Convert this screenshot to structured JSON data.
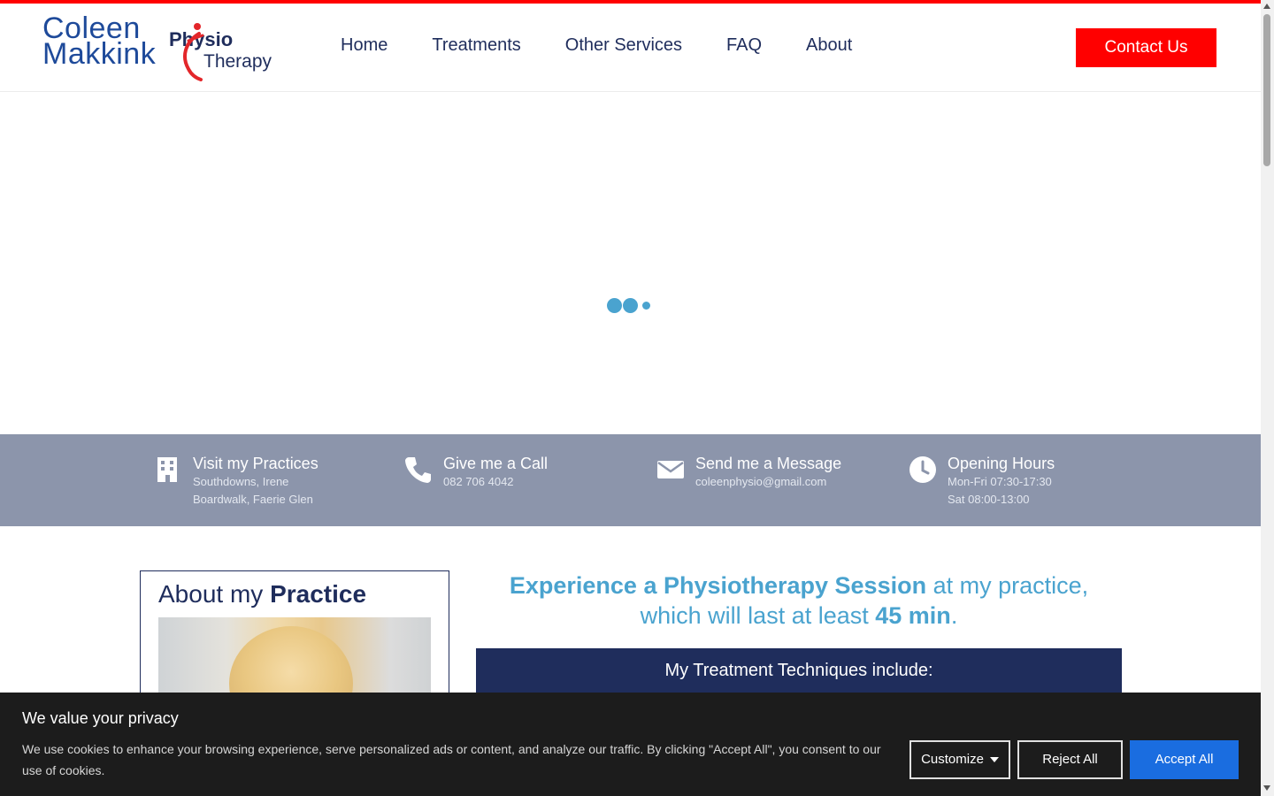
{
  "logo": {
    "name_line1": "Coleen",
    "name_line2": "Makkink",
    "physio": "Physio",
    "therapy": "Therapy"
  },
  "nav": {
    "items": [
      "Home",
      "Treatments",
      "Other Services",
      "FAQ",
      "About"
    ],
    "contact_label": "Contact Us"
  },
  "info": [
    {
      "icon": "building-icon",
      "title": "Visit my Practices",
      "lines": [
        "Southdowns, Irene",
        "Boardwalk, Faerie Glen"
      ]
    },
    {
      "icon": "phone-icon",
      "title": "Give me a Call",
      "lines": [
        "082 706 4042"
      ]
    },
    {
      "icon": "envelope-icon",
      "title": "Send me a Message",
      "lines": [
        "coleenphysio@gmail.com"
      ]
    },
    {
      "icon": "clock-icon",
      "title": "Opening Hours",
      "lines": [
        "Mon-Fri 07:30-17:30",
        "Sat 08:00-13:00"
      ]
    }
  ],
  "about": {
    "title_prefix": "About my ",
    "title_bold": "Practice"
  },
  "experience": {
    "part1_bold": "Experience a Physiotherapy Session",
    "part2": " at my practice, which will last at least ",
    "part3_bold": "45 min",
    "part4": "."
  },
  "techniques": {
    "heading": "My Treatment Techniques include:"
  },
  "cookie": {
    "title": "We value your privacy",
    "text": "We use cookies to enhance your browsing experience, serve personalized ads or content, and analyze our traffic. By clicking \"Accept All\", you consent to our use of cookies.",
    "customize_label": "Customize",
    "reject_label": "Reject All",
    "accept_label": "Accept All"
  },
  "colors": {
    "brand_red": "#ff0000",
    "navy": "#1f2d5c",
    "accent_blue": "#4aa3cf",
    "info_band": "#8c95ab",
    "accept_blue": "#1a6de0"
  }
}
